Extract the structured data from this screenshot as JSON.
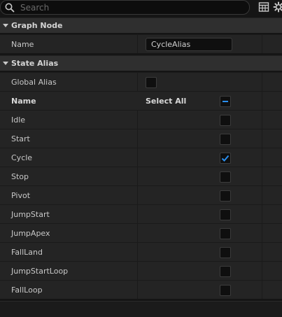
{
  "search": {
    "placeholder": "Search",
    "value": ""
  },
  "toolbar": {
    "icons": [
      "table-icon",
      "settings-icon"
    ]
  },
  "graph_node": {
    "title": "Graph Node",
    "name_label": "Name",
    "name_value": "CycleAlias"
  },
  "state_alias": {
    "title": "State Alias",
    "global_alias_label": "Global Alias",
    "global_alias_checked": false,
    "header_name": "Name",
    "header_select_all": "Select All",
    "select_all_state": "indeterminate",
    "states": [
      {
        "name": "Idle",
        "checked": false
      },
      {
        "name": "Start",
        "checked": false
      },
      {
        "name": "Cycle",
        "checked": true
      },
      {
        "name": "Stop",
        "checked": false
      },
      {
        "name": "Pivot",
        "checked": false
      },
      {
        "name": "JumpStart",
        "checked": false
      },
      {
        "name": "JumpApex",
        "checked": false
      },
      {
        "name": "FallLand",
        "checked": false
      },
      {
        "name": "JumpStartLoop",
        "checked": false
      },
      {
        "name": "FallLoop",
        "checked": false
      }
    ]
  },
  "colors": {
    "accent": "#2a8ff0",
    "background": "#151515",
    "row": "#242424",
    "category": "#2f2f2f"
  }
}
